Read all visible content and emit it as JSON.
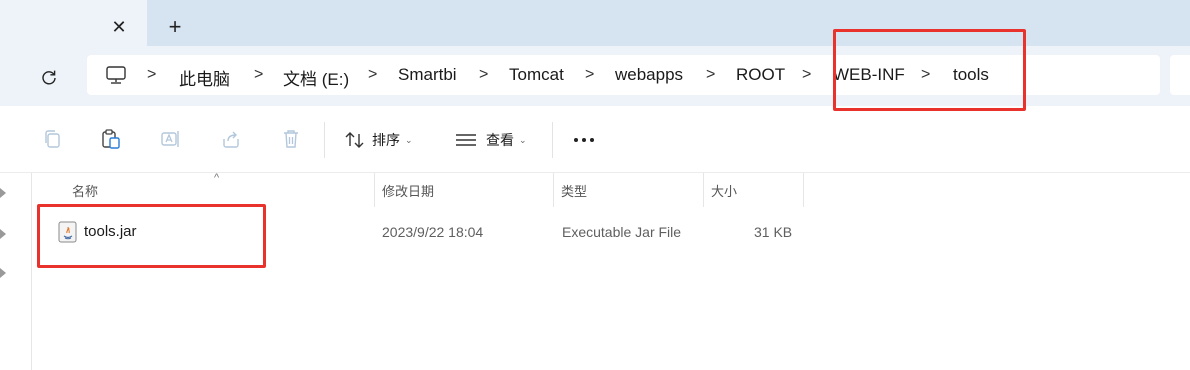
{
  "tab": {
    "close_glyph": "✕",
    "new_glyph": "+"
  },
  "breadcrumb": {
    "items": [
      "此电脑",
      "文档 (E:)",
      "Smartbi",
      "Tomcat",
      "webapps",
      "ROOT",
      "WEB-INF",
      "tools"
    ],
    "separator": ">"
  },
  "toolbar": {
    "sort_label": "排序",
    "view_label": "查看",
    "more_label": "···",
    "dropdown_glyph": "⌄",
    "icons": [
      "copy-icon",
      "paste-icon",
      "rename-icon",
      "share-icon",
      "delete-icon",
      "sort-icon",
      "view-icon",
      "more-icon"
    ]
  },
  "file_list": {
    "columns": [
      "名称",
      "修改日期",
      "类型",
      "大小"
    ],
    "sort_indicator": "^",
    "rows": [
      {
        "name": "tools.jar",
        "modified": "2023/9/22 18:04",
        "type": "Executable Jar File",
        "size": "31 KB"
      }
    ]
  },
  "highlight_color": "#e8322b"
}
